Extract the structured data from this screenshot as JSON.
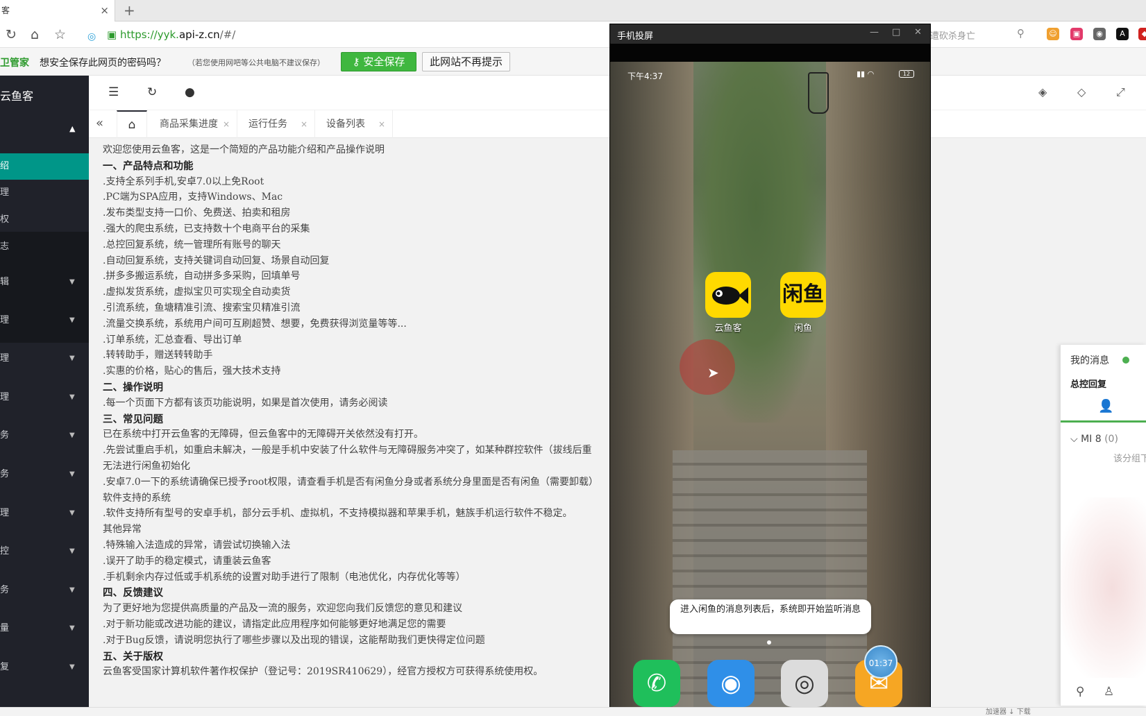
{
  "browser": {
    "tab_label": "客",
    "tab_close": "×",
    "new_tab": "+",
    "url_scheme": "https://yyk.",
    "url_host": "api-z.cn",
    "url_path": "/#/",
    "search_placeholder": "遭砍杀身亡"
  },
  "password_bar": {
    "brand": "卫管家",
    "question": "想安全保存此网页的密码吗？",
    "hint": "（若您使用网吧等公共电脑不建议保存）",
    "save_button": "安全保存",
    "no_button": "此网站不再提示"
  },
  "sidebar": {
    "app_title": "云鱼客",
    "items": [
      {
        "label": "绍"
      },
      {
        "label": "理"
      },
      {
        "label": "权"
      },
      {
        "label": "志"
      }
    ],
    "groups": [
      {
        "label": "辑"
      },
      {
        "label": "理"
      },
      {
        "label": "理"
      },
      {
        "label": "理"
      },
      {
        "label": "务"
      },
      {
        "label": "务"
      },
      {
        "label": "理"
      },
      {
        "label": "控"
      },
      {
        "label": "务"
      },
      {
        "label": "量"
      },
      {
        "label": "复"
      }
    ]
  },
  "tabs": [
    {
      "label": "商品采集进度"
    },
    {
      "label": "运行任务"
    },
    {
      "label": "设备列表"
    }
  ],
  "content": {
    "lines": [
      {
        "text": "欢迎您使用云鱼客，这是一个简短的产品功能介绍和产品操作说明",
        "h": false
      },
      {
        "text": "一、产品特点和功能",
        "h": true
      },
      {
        "text": "  .支持全系列手机,安卓7.0以上免Root",
        "h": false
      },
      {
        "text": "  .PC端为SPA应用，支持Windows、Mac",
        "h": false
      },
      {
        "text": "  .发布类型支持一口价、免费送、拍卖和租房",
        "h": false
      },
      {
        "text": "  .强大的爬虫系统，已支持数十个电商平台的采集",
        "h": false
      },
      {
        "text": "  .总控回复系统，统一管理所有账号的聊天",
        "h": false
      },
      {
        "text": "  .自动回复系统，支持关键词自动回复、场景自动回复",
        "h": false
      },
      {
        "text": "  .拼多多搬运系统，自动拼多多采购，回填单号",
        "h": false
      },
      {
        "text": "  .虚拟发货系统，虚拟宝贝可实现全自动卖货",
        "h": false
      },
      {
        "text": "  .引流系统，鱼塘精准引流、搜索宝贝精准引流",
        "h": false
      },
      {
        "text": "  .流量交换系统，系统用户间可互刷超赞、想要，免费获得浏览量等等...",
        "h": false
      },
      {
        "text": "  .订单系统，汇总查看、导出订单",
        "h": false
      },
      {
        "text": "  .转转助手，赠送转转助手",
        "h": false
      },
      {
        "text": "  .实惠的价格，贴心的售后，强大技术支持",
        "h": false
      },
      {
        "text": "二、操作说明",
        "h": true
      },
      {
        "text": "  .每一个页面下方都有该页功能说明，如果是首次使用，请务必阅读",
        "h": false
      },
      {
        "text": "三、常见问题",
        "h": true
      },
      {
        "text": "  已在系统中打开云鱼客的无障碍，但云鱼客中的无障碍开关依然没有打开。",
        "h": false
      },
      {
        "text": "  .先尝试重启手机，如重启未解决，一般是手机中安装了什么软件与无障碍服务冲突了，如某种群控软件（拔线后重",
        "h": false
      },
      {
        "text": "  无法进行闲鱼初始化",
        "h": false
      },
      {
        "text": "  .安卓7.0一下的系统请确保已授予root权限，请查看手机是否有闲鱼分身或者系统分身里面是否有闲鱼（需要卸载）",
        "h": false
      },
      {
        "text": "  软件支持的系统",
        "h": false
      },
      {
        "text": "  .软件支持所有型号的安卓手机，部分云手机、虚拟机，不支持模拟器和苹果手机，魅族手机运行软件不稳定。",
        "h": false
      },
      {
        "text": "  其他异常",
        "h": false
      },
      {
        "text": "  .特殊输入法造成的异常，请尝试切换输入法",
        "h": false
      },
      {
        "text": "  .误开了助手的稳定模式，请重装云鱼客",
        "h": false
      },
      {
        "text": "  .手机剩余内存过低或手机系统的设置对助手进行了限制（电池优化，内存优化等等）",
        "h": false
      },
      {
        "text": "四、反馈建议",
        "h": true
      },
      {
        "text": "  为了更好地为您提供高质量的产品及一流的服务，欢迎您向我们反馈您的意见和建议",
        "h": false
      },
      {
        "text": "  .对于新功能或改进功能的建议，请指定此应用程序如何能够更好地满足您的需要",
        "h": false
      },
      {
        "text": "  .对于Bug反馈，请说明您执行了哪些步骤以及出现的错误，这能帮助我们更快得定位问题",
        "h": false
      },
      {
        "text": "五、关于版权",
        "h": true
      },
      {
        "text": "  云鱼客受国家计算机软件著作权保护（登记号：2019SR410629），经官方授权方可获得系统使用权。",
        "h": false
      }
    ]
  },
  "phone": {
    "window_title": "手机投屏",
    "time": "下午4:37",
    "battery": "12",
    "apps": [
      {
        "label": "云鱼客"
      },
      {
        "label": "闲鱼"
      }
    ],
    "toast": "进入闲鱼的消息列表后，系统即开始监听消息",
    "timer": "01:37"
  },
  "messages": {
    "title": "我的消息",
    "subtitle": "总控回复",
    "device": "MI 8",
    "device_count": "(0)",
    "note": "该分组下"
  },
  "statusbar": {
    "text": "加速器  ↓ 下载"
  },
  "colors": {
    "sidebar_bg": "#20222a",
    "sidebar_active": "#009688",
    "save_green": "#3fb73f",
    "online_green": "#4caf50"
  }
}
